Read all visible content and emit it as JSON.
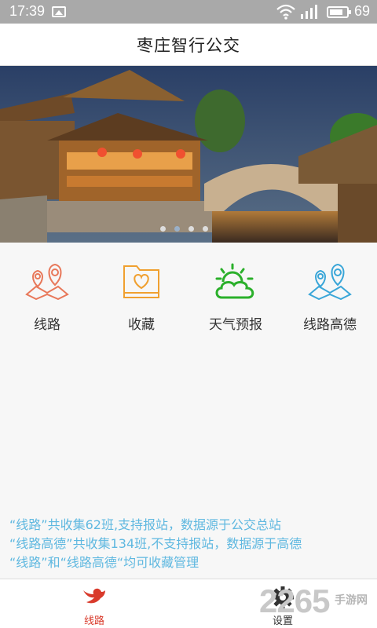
{
  "status_bar": {
    "time": "17:39",
    "battery_level": "69",
    "icons": [
      "image-icon",
      "wifi-icon",
      "signal-icon",
      "battery-icon"
    ]
  },
  "header": {
    "title": "枣庄智行公交"
  },
  "banner": {
    "slide_count": 4,
    "active_slide": 2,
    "image": "night-ancient-town-photo"
  },
  "menu": {
    "items": [
      {
        "label": "线路",
        "icon": "map-pin-icon",
        "color": "#e8785a"
      },
      {
        "label": "收藏",
        "icon": "heart-folder-icon",
        "color": "#f0a030"
      },
      {
        "label": "天气预报",
        "icon": "sun-cloud-icon",
        "color": "#2bb02b"
      },
      {
        "label": "线路高德",
        "icon": "map-pin-icon",
        "color": "#3aa6d8"
      }
    ]
  },
  "notes": [
    "“线路”共收集62班,支持报站，数据源于公交总站",
    "“线路高德”共收集134班,不支持报站，数据源于高德",
    "“线路”和“线路高德“均可收藏管理"
  ],
  "tabbar": {
    "tabs": [
      {
        "label": "线路",
        "icon": "bird-icon",
        "active": true,
        "color": "#d93a2b"
      },
      {
        "label": "设置",
        "icon": "gear-icon",
        "active": false,
        "color": "#333333"
      }
    ]
  },
  "watermark": {
    "number": "2265",
    "text": "手游网"
  }
}
